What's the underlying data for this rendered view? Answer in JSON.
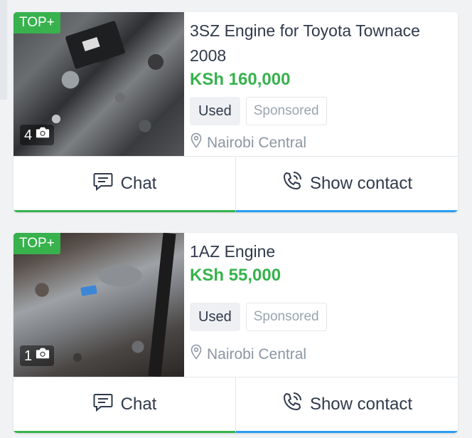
{
  "listings": [
    {
      "badge": "TOP+",
      "photo_count": "4",
      "title": "3SZ Engine for Toyota Townace 2008",
      "price": "KSh 160,000",
      "condition": "Used",
      "sponsored": "Sponsored",
      "location": "Nairobi Central",
      "chat_label": "Chat",
      "contact_label": "Show contact"
    },
    {
      "badge": "TOP+",
      "photo_count": "1",
      "title": "1AZ Engine",
      "price": "KSh 55,000",
      "condition": "Used",
      "sponsored": "Sponsored",
      "location": "Nairobi Central",
      "chat_label": "Chat",
      "contact_label": "Show contact"
    }
  ],
  "icons": {
    "camera": "camera-icon",
    "location": "location-pin-icon",
    "chat": "chat-bubble-icon",
    "phone": "phone-call-icon"
  },
  "colors": {
    "green": "#37b24d",
    "blue": "#2b9df0",
    "text": "#303a4b",
    "muted": "#8c96a3"
  }
}
